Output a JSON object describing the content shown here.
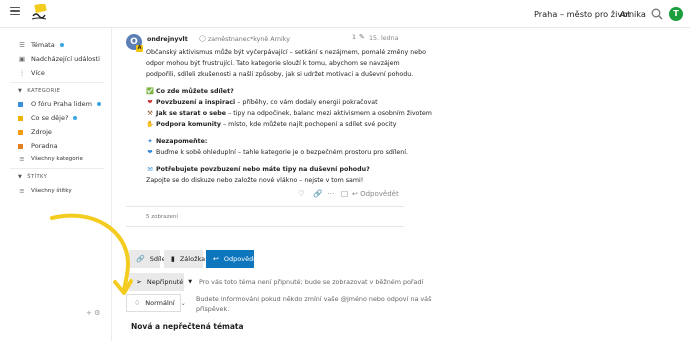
{
  "header": {
    "logo_text": "Arnika",
    "title": "Praha – město pro život",
    "user": "Arnika",
    "avatar_letter": "T"
  },
  "sidebar": {
    "items": [
      {
        "label": "Témata",
        "icon": "layers-icon"
      },
      {
        "label": "Nadcházející události",
        "icon": "calendar-icon"
      },
      {
        "label": "Více",
        "icon": "more-icon"
      }
    ],
    "categories_heading": "KATEGORIE",
    "categories": [
      {
        "label": "O fóru Praha lidem",
        "color": "#3a8fd8"
      },
      {
        "label": "Co se děje?",
        "color": "#f0b400"
      },
      {
        "label": "Zdroje",
        "color": "#f39c12"
      },
      {
        "label": "Poradna",
        "color": "#e67e22"
      }
    ],
    "all_categories": "Všechny kategorie",
    "tags_heading": "ŠTÍTKY",
    "all_tags": "Všechny štítky"
  },
  "post": {
    "avatar_letter": "O",
    "author": "ondrejnyvlt",
    "author_title": "zaměstnanec*kyně Arniky",
    "edits": "1",
    "date": "15. ledna",
    "intro_lines": [
      "Občanský aktivismus může být vyčerpávající – setkání s nezájmem, pomalé změny nebo",
      "odpor mohou být frustrující. Tato kategorie slouží k tomu, abychom se navzájem",
      "podpořili, sdíleli zkušenosti a našli způsoby, jak si udržet motivaci a duševní pohodu."
    ],
    "q1": "Co zde můžete sdílet?",
    "b1_bold": "Povzbuzení a inspiraci",
    "b1_rest": " – příběhy, co vám dodaly energii pokračovat",
    "b2_bold": "Jak se starat o sebe",
    "b2_rest": " – tipy na odpočinek, balanc mezi aktivismem a osobním životem",
    "b3_bold": "Podpora komunity",
    "b3_rest": " – místo, kde můžete najít pochopení a sdílet své pocity",
    "q2": "Nezapomeňte:",
    "q2_line": "Buďme k sobě ohleduplní – tahle kategorie je o bezpečném prostoru pro sdílení.",
    "q3": "Potřebujete povzbuzení nebo máte tipy na duševní pohodu?",
    "q3_line": "Zapojte se do diskuze nebo založte nové vlákno – nejste v tom sami!",
    "reply": "Odpovědět",
    "views": "5 zobrazení"
  },
  "footer_buttons": {
    "share": "Sdílet",
    "bookmark": "Záložka",
    "reply": "Odpovědět"
  },
  "pin": {
    "label": "Nepřipnuté",
    "note": "Pro vás toto téma není připnuté; bude se zobrazovat v běžném pořadí"
  },
  "notify": {
    "label": "Normální",
    "note_lines": [
      "Budete informováni pokud někdo zmíní vaše @jméno nebo odpoví na váš",
      "příspěvek."
    ]
  },
  "section_title": "Nová a nepřečtená témata",
  "colors": {
    "accent": "#0e76bd",
    "avatar_green": "#1b9e3b",
    "arrow_yellow": "#f4cc1f"
  }
}
